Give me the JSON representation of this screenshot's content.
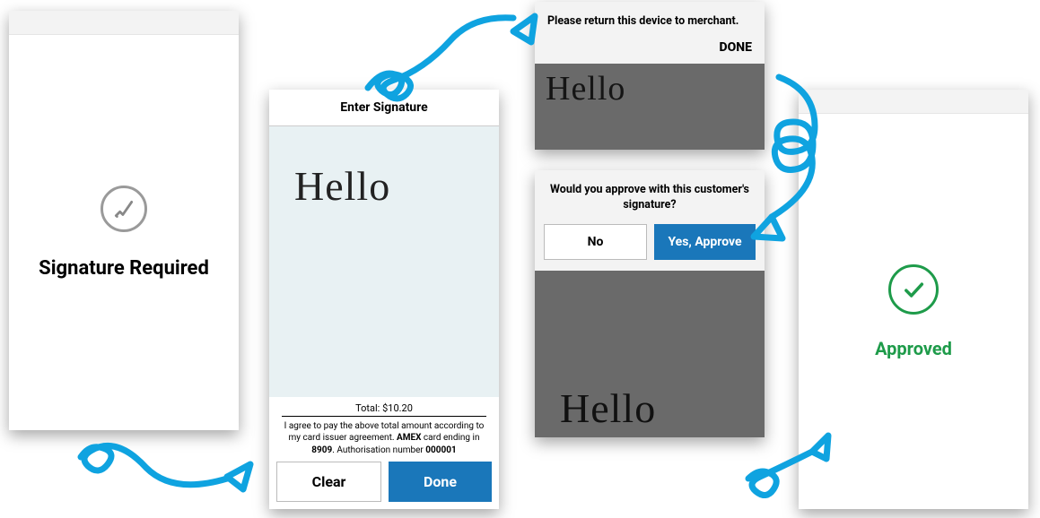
{
  "screen1": {
    "title": "Signature Required",
    "icon": "signature-icon"
  },
  "screen2": {
    "header": "Enter Signature",
    "signature_text": "Hello",
    "total_label": "Total: ",
    "total_value": "$10.20",
    "legal_pre": "I agree to pay the above total amount according to my card issuer agreement. ",
    "card_brand": "AMEX",
    "legal_mid": " card ending in ",
    "card_last4": "8909",
    "legal_period": ". ",
    "auth_label": "Authorisation number ",
    "auth_number": "000001",
    "clear_label": "Clear",
    "done_label": "Done"
  },
  "screen3a": {
    "message": "Please return this device to merchant.",
    "done_label": "DONE",
    "bg_signature": "Hello"
  },
  "screen3b": {
    "message": "Would you approve with this customer's signature?",
    "no_label": "No",
    "yes_label": "Yes, Approve",
    "bg_signature": "Hello"
  },
  "screen4": {
    "title": "Approved",
    "icon": "check-icon"
  }
}
